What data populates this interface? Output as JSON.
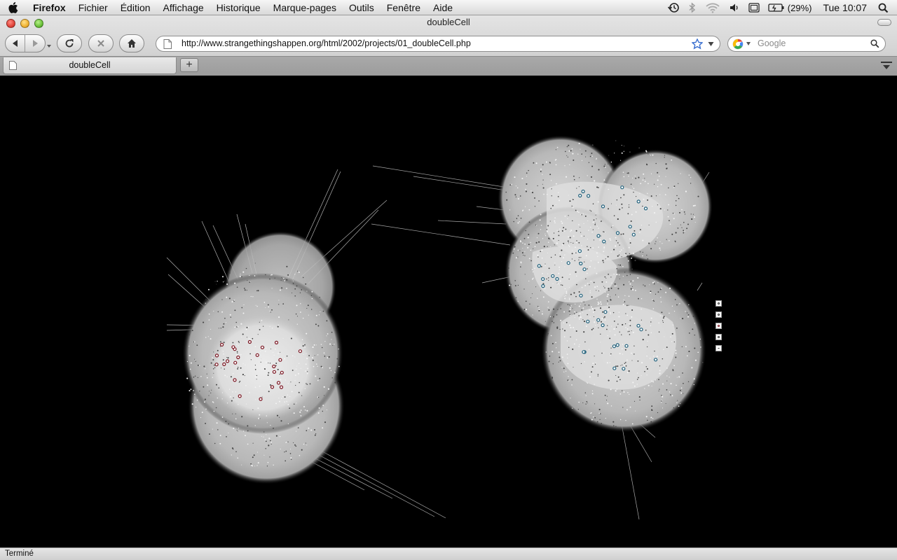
{
  "menubar": {
    "app_name": "Firefox",
    "items": [
      "Fichier",
      "Édition",
      "Affichage",
      "Historique",
      "Marque-pages",
      "Outils",
      "Fenêtre",
      "Aide"
    ],
    "battery": "(29%)",
    "clock": "Tue 10:07"
  },
  "window": {
    "title": "doubleCell"
  },
  "navbar": {
    "url": "http://www.strangethingshappen.org/html/2002/projects/01_doubleCell.php",
    "search_placeholder": "Google"
  },
  "tabs": [
    {
      "label": "doubleCell"
    }
  ],
  "status": {
    "text": "Terminé"
  },
  "colors": {
    "content_background": "#000000",
    "cell_fill": "#bdbdbd",
    "cell_core": "#e3e3e3",
    "left_cell_marker": "#7a1420",
    "right_cell_marker": "#1e5f7a"
  },
  "icons": {
    "apple": "apple-logo-icon",
    "back": "back-arrow-icon",
    "forward": "forward-arrow-icon",
    "reload": "reload-icon",
    "stop": "stop-icon",
    "home": "home-icon",
    "bookmark": "star-icon",
    "search_engine": "google-logo-icon",
    "time_machine": "time-machine-icon",
    "bluetooth": "bluetooth-icon",
    "wifi": "wifi-icon",
    "volume": "volume-icon",
    "spotlight": "spotlight-search-icon"
  }
}
